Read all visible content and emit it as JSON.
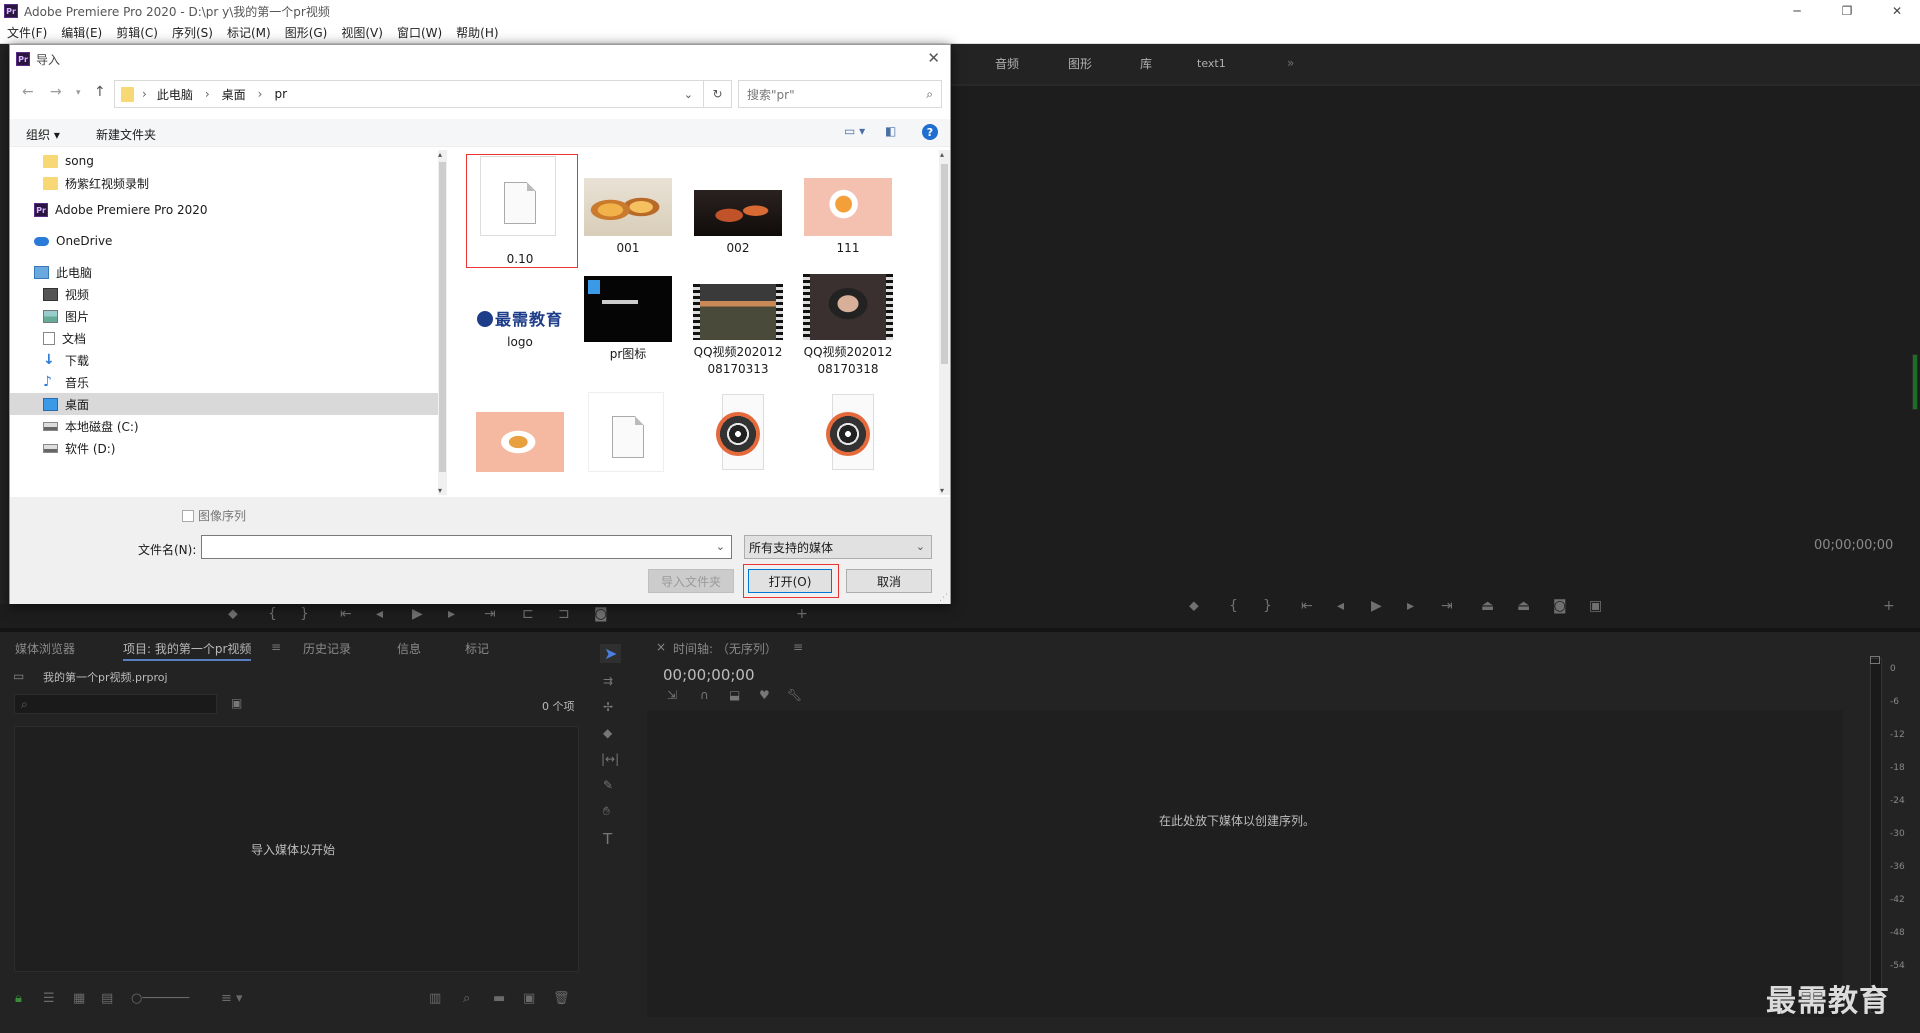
{
  "app": {
    "title": "Adobe Premiere Pro 2020 - D:\\pr y\\我的第一个pr视频",
    "logo_text": "Pr",
    "menus": [
      "文件(F)",
      "编辑(E)",
      "剪辑(C)",
      "序列(S)",
      "标记(M)",
      "图形(G)",
      "视图(V)",
      "窗口(W)",
      "帮助(H)"
    ]
  },
  "workspace_tabs": [
    "音频",
    "图形",
    "库",
    "text1"
  ],
  "program_monitor": {
    "timecode": "00;00;00;00"
  },
  "project_panel": {
    "tabs": [
      "媒体浏览器",
      "项目: 我的第一个pr视频",
      "历史记录",
      "信息",
      "标记"
    ],
    "file_name": "我的第一个pr视频.prproj",
    "item_count": "0 个项",
    "empty_text": "导入媒体以开始"
  },
  "timeline": {
    "title": "时间轴: （无序列）",
    "timecode": "00;00;00;00",
    "empty_text": "在此处放下媒体以创建序列。"
  },
  "audio_meter": {
    "scale": [
      "0",
      "-6",
      "-12",
      "-18",
      "-24",
      "-30",
      "-36",
      "-42",
      "-48",
      "-54"
    ]
  },
  "watermark": "最需教育",
  "dialog": {
    "title": "导入",
    "breadcrumb": [
      "此电脑",
      "桌面",
      "pr"
    ],
    "search_placeholder": "搜索\"pr\"",
    "toolbar": {
      "organize": "组织 ▾",
      "new_folder": "新建文件夹"
    },
    "nav_items": [
      {
        "label": "song",
        "icon": "folder"
      },
      {
        "label": "杨紫红视频录制",
        "icon": "folder"
      },
      {
        "label": "Adobe Premiere Pro 2020",
        "icon": "pr"
      },
      {
        "label": "OneDrive",
        "icon": "cloud"
      },
      {
        "label": "此电脑",
        "icon": "pc"
      },
      {
        "label": "视频",
        "icon": "video"
      },
      {
        "label": "图片",
        "icon": "picture"
      },
      {
        "label": "文档",
        "icon": "document"
      },
      {
        "label": "下载",
        "icon": "download"
      },
      {
        "label": "音乐",
        "icon": "music"
      },
      {
        "label": "桌面",
        "icon": "desktop"
      },
      {
        "label": "本地磁盘 (C:)",
        "icon": "drive"
      },
      {
        "label": "软件 (D:)",
        "icon": "drive"
      }
    ],
    "files": [
      "0.10",
      "001",
      "002",
      "111",
      "logo",
      "pr图标",
      "QQ视频20201208170313",
      "QQ视频20201208170318",
      "",
      "",
      "",
      ""
    ],
    "logo_thumb_text": "最需教育",
    "image_sequence_label": "图像序列",
    "filename_label": "文件名(N):",
    "filename_value": "",
    "filter_value": "所有支持的媒体",
    "buttons": {
      "import_folder": "导入文件夹",
      "open": "打开(O)",
      "cancel": "取消"
    }
  }
}
